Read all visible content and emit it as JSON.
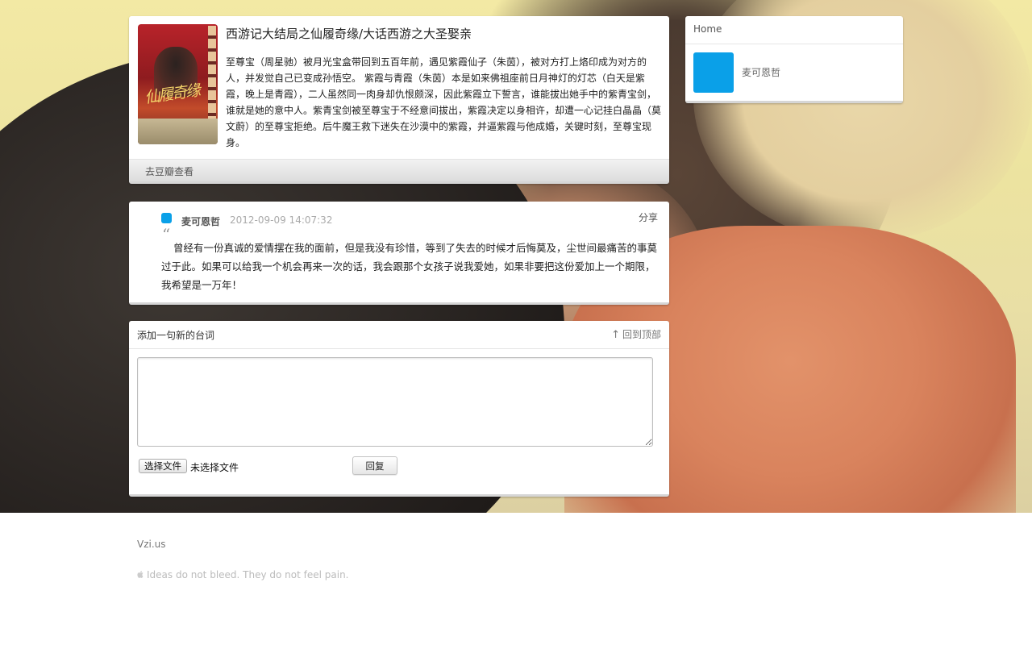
{
  "movie": {
    "title": "西游记大结局之仙履奇缘/大话西游之大圣娶亲",
    "poster_art_text": "仙履奇缘",
    "description": "至尊宝（周星驰）被月光宝盒带回到五百年前，遇见紫霞仙子（朱茵），被对方打上烙印成为对方的人，并发觉自己已变成孙悟空。 紫霞与青霞（朱茵）本是如来佛祖座前日月神灯的灯芯（白天是紫霞，晚上是青霞），二人虽然同一肉身却仇恨颇深，因此紫霞立下誓言，谁能拔出她手中的紫青宝剑，谁就是她的意中人。紫青宝剑被至尊宝于不经意间拔出，紫霞决定以身相许，却遭一心记挂白晶晶（莫文蔚）的至尊宝拒绝。后牛魔王救下迷失在沙漠中的紫霞，并逼紫霞与他成婚，关键时刻，至尊宝现身。",
    "douban_link": "去豆瓣查看"
  },
  "quote": {
    "user": "麦可恩哲",
    "timestamp": "2012-09-09 14:07:32",
    "share": "分享",
    "quote_mark": "“",
    "text": "曾经有一份真诚的爱情摆在我的面前，但是我没有珍惜，等到了失去的时候才后悔莫及，尘世间最痛苦的事莫过于此。如果可以给我一个机会再来一次的话，我会跟那个女孩子说我爱她，如果非要把这份爱加上一个期限，我希望是一万年！"
  },
  "reply": {
    "title": "添加一句新的台词",
    "back_to_top": "回到顶部",
    "back_to_top_icon": "up-arrow-icon",
    "textarea_value": "",
    "file_button": "选择文件",
    "file_status": "未选择文件",
    "submit": "回复"
  },
  "sidebar": {
    "home": "Home",
    "username": "麦可恩哲",
    "avatar_color": "#0aa0e8"
  },
  "footer": {
    "site": "Vzi.us",
    "tagline": "Ideas do not bleed. They do not feel pain.",
    "tagline_icon": "apple-icon"
  },
  "colors": {
    "accent": "#0aa0e8"
  }
}
